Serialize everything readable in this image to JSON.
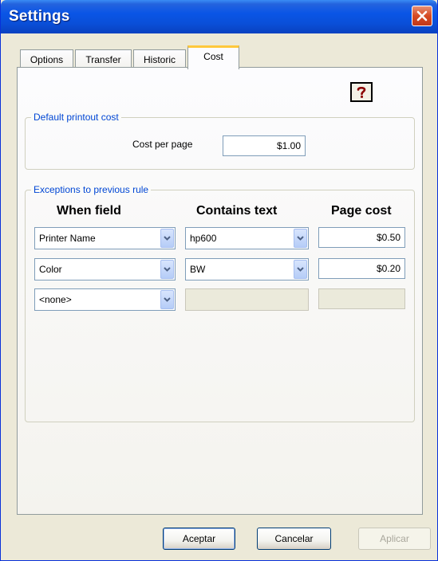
{
  "window": {
    "title": "Settings"
  },
  "tabs": [
    {
      "label": "Options"
    },
    {
      "label": "Transfer"
    },
    {
      "label": "Historic"
    },
    {
      "label": "Cost",
      "active": true
    }
  ],
  "default_group": {
    "legend": "Default printout cost",
    "cost_label": "Cost per page",
    "cost_value": "$1.00"
  },
  "exceptions_group": {
    "legend": "Exceptions to previous rule",
    "headers": {
      "when_field": "When field",
      "contains_text": "Contains text",
      "page_cost": "Page cost"
    },
    "rows": [
      {
        "field": "Printer Name",
        "text": "hp600",
        "cost": "$0.50"
      },
      {
        "field": "Color",
        "text": "BW",
        "cost": "$0.20"
      },
      {
        "field": "<none>",
        "text": "",
        "cost": ""
      }
    ]
  },
  "buttons": {
    "accept": "Aceptar",
    "cancel": "Cancelar",
    "apply": "Aplicar"
  },
  "colors": {
    "titlebar": "#0a4fd8",
    "legend_text": "#0046d5",
    "active_tab_accent": "#ffc83c",
    "close_button": "#d64a22"
  },
  "icons": {
    "close": "close-icon",
    "help": "help-icon",
    "dropdown": "chevron-down-icon"
  }
}
